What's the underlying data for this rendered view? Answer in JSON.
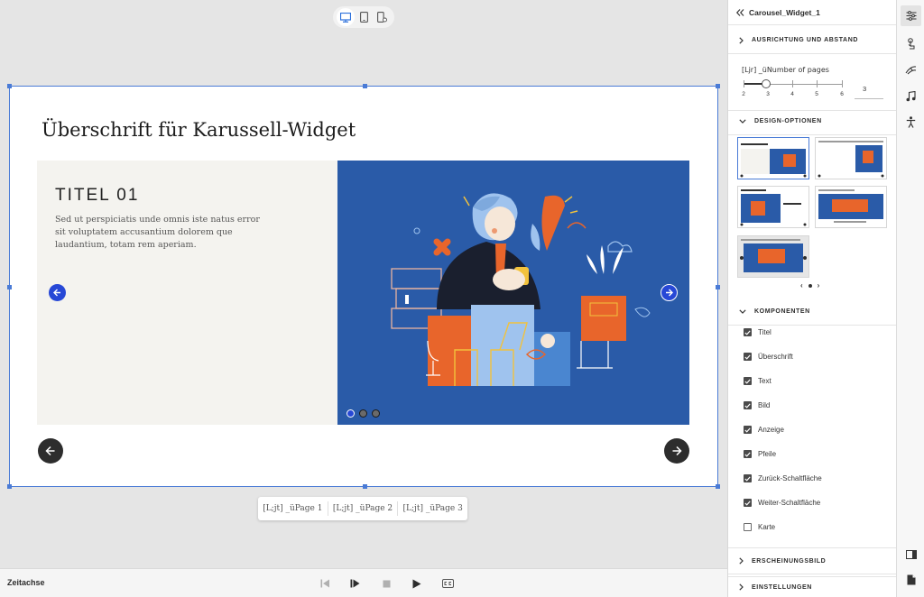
{
  "device_toggle": {
    "options": [
      "desktop",
      "tablet",
      "mobile"
    ],
    "active": "desktop"
  },
  "slide": {
    "heading": "Überschrift für Karussell-Widget",
    "title": "TITEL 01",
    "text": "Sed ut perspiciatis unde omnis iste natus error sit voluptatem accusantium dolorem que laudantium, totam rem aperiam.",
    "indicator_count": 3,
    "active_indicator": 1
  },
  "page_tabs": [
    "[L;jt] _üPage 1",
    "[L;jt] _üPage 2",
    "[L;jt] _üPage 3"
  ],
  "timeline": {
    "label": "Zeitachse"
  },
  "properties": {
    "widget_name": "Carousel_Widget_1",
    "sections": {
      "alignment": "AUSRICHTUNG UND ABSTAND",
      "design": "DESIGN-OPTIONEN",
      "components": "KOMPONENTEN",
      "appearance": "ERSCHEINUNGSBILD",
      "settings": "EINSTELLUNGEN"
    },
    "pages": {
      "label": "[Ljr] _üNumber of pages",
      "value": "3",
      "min": 2,
      "max": 6,
      "ticks": [
        "2",
        "3",
        "4",
        "5",
        "6"
      ]
    },
    "components": [
      {
        "label": "Titel",
        "checked": true
      },
      {
        "label": "Überschrift",
        "checked": true
      },
      {
        "label": "Text",
        "checked": true
      },
      {
        "label": "Bild",
        "checked": true
      },
      {
        "label": "Anzeige",
        "checked": true
      },
      {
        "label": "Pfeile",
        "checked": true
      },
      {
        "label": "Zurück-Schaltfläche",
        "checked": true
      },
      {
        "label": "Weiter-Schaltfläche",
        "checked": true
      },
      {
        "label": "Karte",
        "checked": false
      }
    ]
  },
  "colors": {
    "accent": "#2748d6",
    "image_bg": "#2a5ba8",
    "selection": "#4a7bd6",
    "orange": "#e8652b",
    "dark_button": "#2d2d2d"
  }
}
